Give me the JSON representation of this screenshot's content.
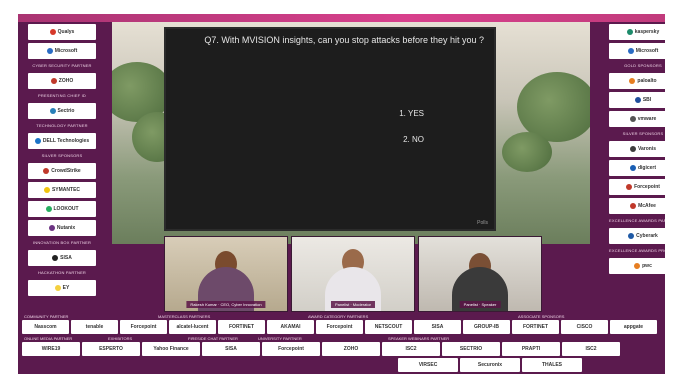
{
  "screen": {
    "question": "Q7. With MVISION insights, can you stop attacks before they hit you ?",
    "options": [
      {
        "num": "1.",
        "label": "YES"
      },
      {
        "num": "2.",
        "label": "NO"
      }
    ],
    "brand": "Polls"
  },
  "left_sidebar": [
    {
      "type": "logo",
      "text": "Qualys",
      "color": "#d6392b"
    },
    {
      "type": "logo",
      "text": "Microsoft",
      "color": "#2b6cc4"
    },
    {
      "type": "cap",
      "text": "CYBER SECURITY PARTNER"
    },
    {
      "type": "logo",
      "text": "ZOHO",
      "color": "#c0392b"
    },
    {
      "type": "cap",
      "text": "PRESENTING CHIEF ID"
    },
    {
      "type": "logo",
      "text": "Sectrio",
      "color": "#2980b9"
    },
    {
      "type": "cap",
      "text": "TECHNOLOGY PARTNER"
    },
    {
      "type": "logo",
      "text": "DELL Technologies",
      "color": "#1a73c7"
    },
    {
      "type": "cap",
      "text": "SILVER SPONSORS"
    },
    {
      "type": "logo",
      "text": "CrowdStrike",
      "color": "#c0392b"
    },
    {
      "type": "logo",
      "text": "SYMANTEC",
      "color": "#f1c40f"
    },
    {
      "type": "logo",
      "text": "LOOKOUT",
      "color": "#27ae60"
    },
    {
      "type": "logo",
      "text": "Nutanix",
      "color": "#6c3483"
    },
    {
      "type": "cap",
      "text": "INNOVATION BOX PARTNER"
    },
    {
      "type": "logo",
      "text": "SISA",
      "color": "#222222"
    },
    {
      "type": "cap",
      "text": "HACKATHON PARTNER"
    },
    {
      "type": "logo",
      "text": "EY",
      "color": "#f4d03f"
    }
  ],
  "right_sidebar": [
    {
      "type": "logo",
      "text": "kaspersky",
      "color": "#1d8b6b"
    },
    {
      "type": "logo",
      "text": "Microsoft",
      "color": "#2b6cc4"
    },
    {
      "type": "cap",
      "text": "GOLD SPONSORS"
    },
    {
      "type": "logo",
      "text": "paloalto",
      "color": "#e67e22"
    },
    {
      "type": "logo",
      "text": "SBI",
      "color": "#1f4e9c"
    },
    {
      "type": "logo",
      "text": "vmware",
      "color": "#555555"
    },
    {
      "type": "cap",
      "text": "SILVER SPONSORS"
    },
    {
      "type": "logo",
      "text": "Varonis",
      "color": "#3d3d3d"
    },
    {
      "type": "logo",
      "text": "digicert",
      "color": "#1a5fb4"
    },
    {
      "type": "logo",
      "text": "Forcepoint",
      "color": "#c0392b"
    },
    {
      "type": "logo",
      "text": "McAfee",
      "color": "#c0392b"
    },
    {
      "type": "cap",
      "text": "EXCELLENCE AWARDS PARTNER"
    },
    {
      "type": "logo",
      "text": "Cyberark",
      "color": "#1f5aa6"
    },
    {
      "type": "cap",
      "text": "EXCELLENCE AWARDS PROVISION PARTNER"
    },
    {
      "type": "logo",
      "text": "pwc",
      "color": "#e67e22"
    }
  ],
  "participants": [
    {
      "name": "Rakesh Kumar",
      "role": "CEO, Cyber Innovation"
    },
    {
      "name": "Panelist",
      "role": "Moderator"
    },
    {
      "name": "Panelist",
      "role": "Speaker"
    }
  ],
  "bottom": {
    "row1_caps": [
      "COMMUNITY PARTNER",
      "MASTERCLASS PARTNERS",
      "AWARD CATEGORY PARTNERS",
      "ASSOCIATE SPONSORS"
    ],
    "row1": [
      "Nasscom",
      "tenable",
      "Forcepoint",
      "alcatel-lucent",
      "FORTINET",
      "AKAMAI",
      "Forcepoint",
      "NETSCOUT",
      "SISA",
      "GROUP-IB",
      "FORTINET",
      "CISCO",
      "appgate"
    ],
    "row2_caps": [
      "ONLINE MEDIA PARTNER",
      "EXHIBITORS",
      "FIRESIDE CHAT PARTNER",
      "UNIVERSITY PARTNER",
      "SPEAKER WEBINARS PARTNER"
    ],
    "row2": [
      "WIRE19",
      "ESPERTO",
      "Yahoo Finance",
      "SISA",
      "Forcepoint",
      "ZOHO",
      "ISC2",
      "SECTRIO",
      "PRAPTI",
      "ISC2"
    ],
    "row3": [
      "VIRSEC",
      "Securonix",
      "THALES"
    ]
  },
  "colors": {
    "frame": "#5b1a4e",
    "accent": "#d8408c",
    "screen": "#1d1d1d"
  }
}
